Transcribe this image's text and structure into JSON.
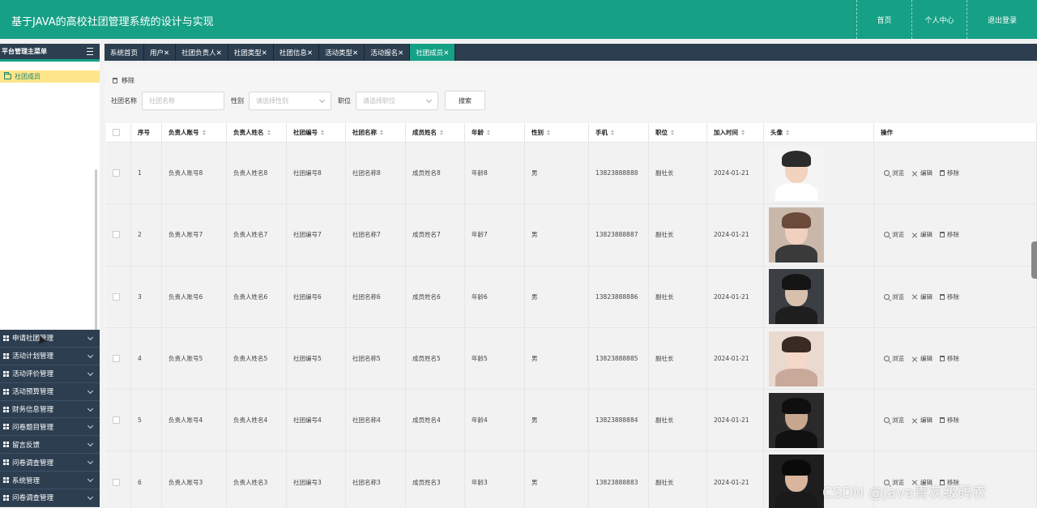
{
  "header": {
    "title": "基于JAVA的高校社团管理系统的设计与实现",
    "nav": [
      "首页",
      "个人中心",
      "退出登录"
    ]
  },
  "sidebar": {
    "heading": "平台管理主菜单",
    "active_item": "社团成员",
    "menu": [
      "申请社团管理",
      "活动计划管理",
      "活动评价管理",
      "活动预算管理",
      "财务信息管理",
      "问卷题目管理",
      "留言反馈",
      "问卷调查管理",
      "系统管理",
      "问卷调查管理"
    ]
  },
  "tabs": [
    "系统首页",
    "用户✕",
    "社团负责人✕",
    "社团类型✕",
    "社团信息✕",
    "活动类型✕",
    "活动报名✕",
    "社团成员✕"
  ],
  "toolbar": {
    "remove_label": "移除"
  },
  "search": {
    "club_name_label": "社团名称",
    "club_name_placeholder": "社团名称",
    "gender_label": "性别",
    "gender_placeholder": "请选择性别",
    "position_label": "职位",
    "position_placeholder": "请选择职位",
    "search_button": "搜索"
  },
  "table": {
    "columns": [
      "序号",
      "负责人账号",
      "负责人姓名",
      "社团编号",
      "社团名称",
      "成员姓名",
      "年龄",
      "性别",
      "手机",
      "职位",
      "加入时间",
      "头像",
      "操作"
    ],
    "actions": {
      "view": "浏览",
      "edit": "编辑",
      "remove": "移除"
    },
    "rows": [
      {
        "no": "1",
        "account": "负责人账号8",
        "name": "负责人姓名8",
        "club_no": "社团编号8",
        "club_name": "社团名称8",
        "member": "成员姓名8",
        "age": "年龄8",
        "gender": "男",
        "phone": "13823888888",
        "position": "副社长",
        "joined": "2024-01-21"
      },
      {
        "no": "2",
        "account": "负责人账号7",
        "name": "负责人姓名7",
        "club_no": "社团编号7",
        "club_name": "社团名称7",
        "member": "成员姓名7",
        "age": "年龄7",
        "gender": "男",
        "phone": "13823888887",
        "position": "副社长",
        "joined": "2024-01-21"
      },
      {
        "no": "3",
        "account": "负责人账号6",
        "name": "负责人姓名6",
        "club_no": "社团编号6",
        "club_name": "社团名称6",
        "member": "成员姓名6",
        "age": "年龄6",
        "gender": "男",
        "phone": "13823888886",
        "position": "副社长",
        "joined": "2024-01-21"
      },
      {
        "no": "4",
        "account": "负责人账号5",
        "name": "负责人姓名5",
        "club_no": "社团编号5",
        "club_name": "社团名称5",
        "member": "成员姓名5",
        "age": "年龄5",
        "gender": "男",
        "phone": "13823888885",
        "position": "副社长",
        "joined": "2024-01-21"
      },
      {
        "no": "5",
        "account": "负责人账号4",
        "name": "负责人姓名4",
        "club_no": "社团编号4",
        "club_name": "社团名称4",
        "member": "成员姓名4",
        "age": "年龄4",
        "gender": "男",
        "phone": "13823888884",
        "position": "副社长",
        "joined": "2024-01-21"
      },
      {
        "no": "6",
        "account": "负责人账号3",
        "name": "负责人姓名3",
        "club_no": "社团编号3",
        "club_name": "社团名称3",
        "member": "成员姓名3",
        "age": "年龄3",
        "gender": "男",
        "phone": "13823888883",
        "position": "副社长",
        "joined": "2024-01-21"
      }
    ]
  },
  "watermark": "CSDN @Java青灰级码农",
  "colors": {
    "brand": "#16a085",
    "dark": "#2c3e50",
    "active_item": "#fde68a"
  }
}
